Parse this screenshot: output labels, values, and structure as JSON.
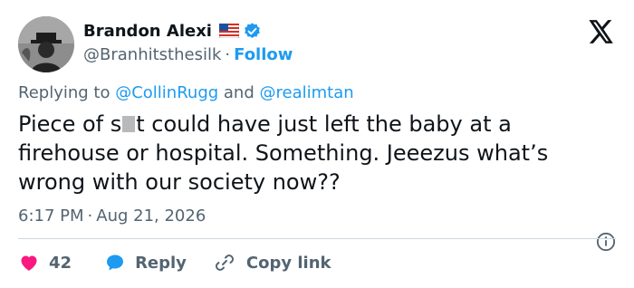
{
  "author": {
    "display_name": "Brandon Alexi",
    "handle": "@Branhitsthesilk",
    "follow_label": "Follow",
    "separator": "·",
    "flag_icon": "us-flag-icon",
    "verified_icon": "verified-badge-icon"
  },
  "brand": {
    "logo_icon": "x-logo-icon"
  },
  "reply_context": {
    "prefix": "Replying to",
    "mention1": "@CollinRugg",
    "conjunction": "and",
    "mention2": "@realimtan"
  },
  "tweet": {
    "text_before_censor": "Piece of s",
    "text_after_censor": "t could have just left the baby at a firehouse or hospital. Something. Jeeezus what’s wrong with our society now??"
  },
  "meta": {
    "time": "6:17 PM",
    "separator": "·",
    "date": "Aug 21, 2026",
    "info_icon": "info-icon"
  },
  "actions": {
    "like_count": "42",
    "reply_label": "Reply",
    "copy_label": "Copy link"
  },
  "colors": {
    "accent": "#1d9bf0",
    "like": "#f91880",
    "text": "#0f1419",
    "secondary": "#536471"
  }
}
